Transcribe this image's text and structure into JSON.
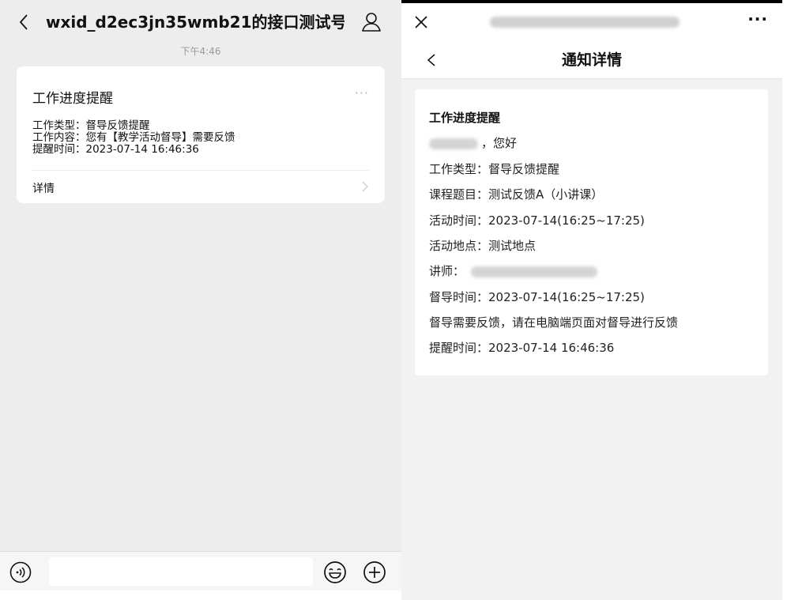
{
  "chat": {
    "title": "wxid_d2ec3jn35wmb21的接口测试号",
    "timestamp": "下午4:46",
    "card": {
      "title": "工作进度提醒",
      "more": "···",
      "lines": [
        "工作类型：督导反馈提醒",
        "工作内容：您有【教学活动督导】需要反馈",
        "提醒时间：2023-07-14 16:46:36"
      ],
      "detail_label": "详情"
    },
    "input": {
      "value": "",
      "placeholder": ""
    }
  },
  "detail_page": {
    "nav_title": "通知详情",
    "menu": "···",
    "card": {
      "title": "工作进度提醒",
      "greeting": "，您好",
      "work_type": "工作类型：督导反馈提醒",
      "course": "课程题目：测试反馈A（小讲课）",
      "activity_time": "活动时间：2023-07-14(16:25~17:25)",
      "activity_place": "活动地点：测试地点",
      "teacher_label": "讲师：",
      "supervise_time": "督导时间：2023-07-14(16:25~17:25)",
      "feedback_note": "督导需要反馈，请在电脑端页面对督导进行反馈",
      "remind_time": "提醒时间：2023-07-14 16:46:36"
    }
  },
  "icons": {
    "back": "chevron-left-icon",
    "user": "user-icon",
    "close": "close-icon",
    "voice": "voice-icon",
    "emoji": "emoji-icon",
    "plus": "plus-icon"
  },
  "colors": {
    "chat_bg": "#ededed",
    "card_bg": "#ffffff",
    "detail_bg": "#f2f2f2",
    "text": "#111111",
    "muted": "#9a9a9a"
  }
}
